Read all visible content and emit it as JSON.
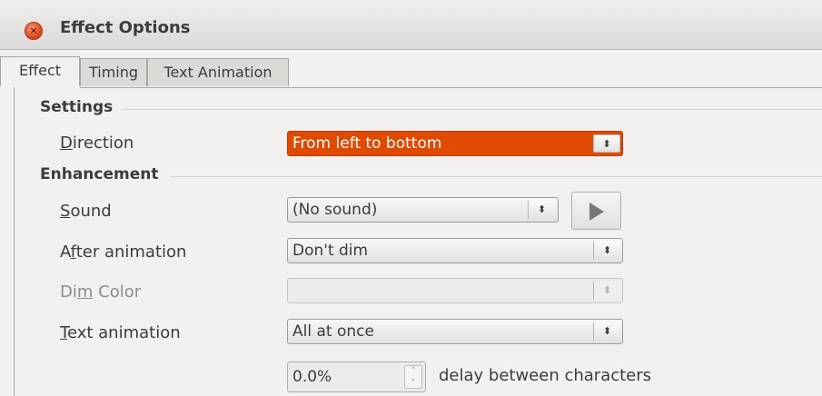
{
  "window": {
    "title": "Effect Options",
    "close_glyph": "×"
  },
  "tabs": [
    {
      "label": "Effect",
      "active": true
    },
    {
      "label": "Timing",
      "active": false
    },
    {
      "label": "Text Animation",
      "active": false
    }
  ],
  "settings": {
    "heading": "Settings",
    "direction": {
      "label_pre": "",
      "label_mnemonic": "D",
      "label_post": "irection",
      "value": "From left to bottom"
    }
  },
  "enhancement": {
    "heading": "Enhancement",
    "sound": {
      "label_pre": "",
      "label_mnemonic": "S",
      "label_post": "ound",
      "value": "(No sound)",
      "play_icon": "play-icon"
    },
    "after_animation": {
      "label_pre": "A",
      "label_mnemonic": "f",
      "label_post": "ter animation",
      "value": "Don't dim"
    },
    "dim_color": {
      "label_pre": "Di",
      "label_mnemonic": "m",
      "label_post": " Color",
      "value": ""
    },
    "text_animation": {
      "label_pre": "",
      "label_mnemonic": "T",
      "label_post": "ext animation",
      "value": "All at once"
    },
    "delay": {
      "value": "0.0%",
      "suffix": "delay between characters"
    }
  },
  "colors": {
    "selected": "#df4a00",
    "close_button": "#df4b20"
  }
}
